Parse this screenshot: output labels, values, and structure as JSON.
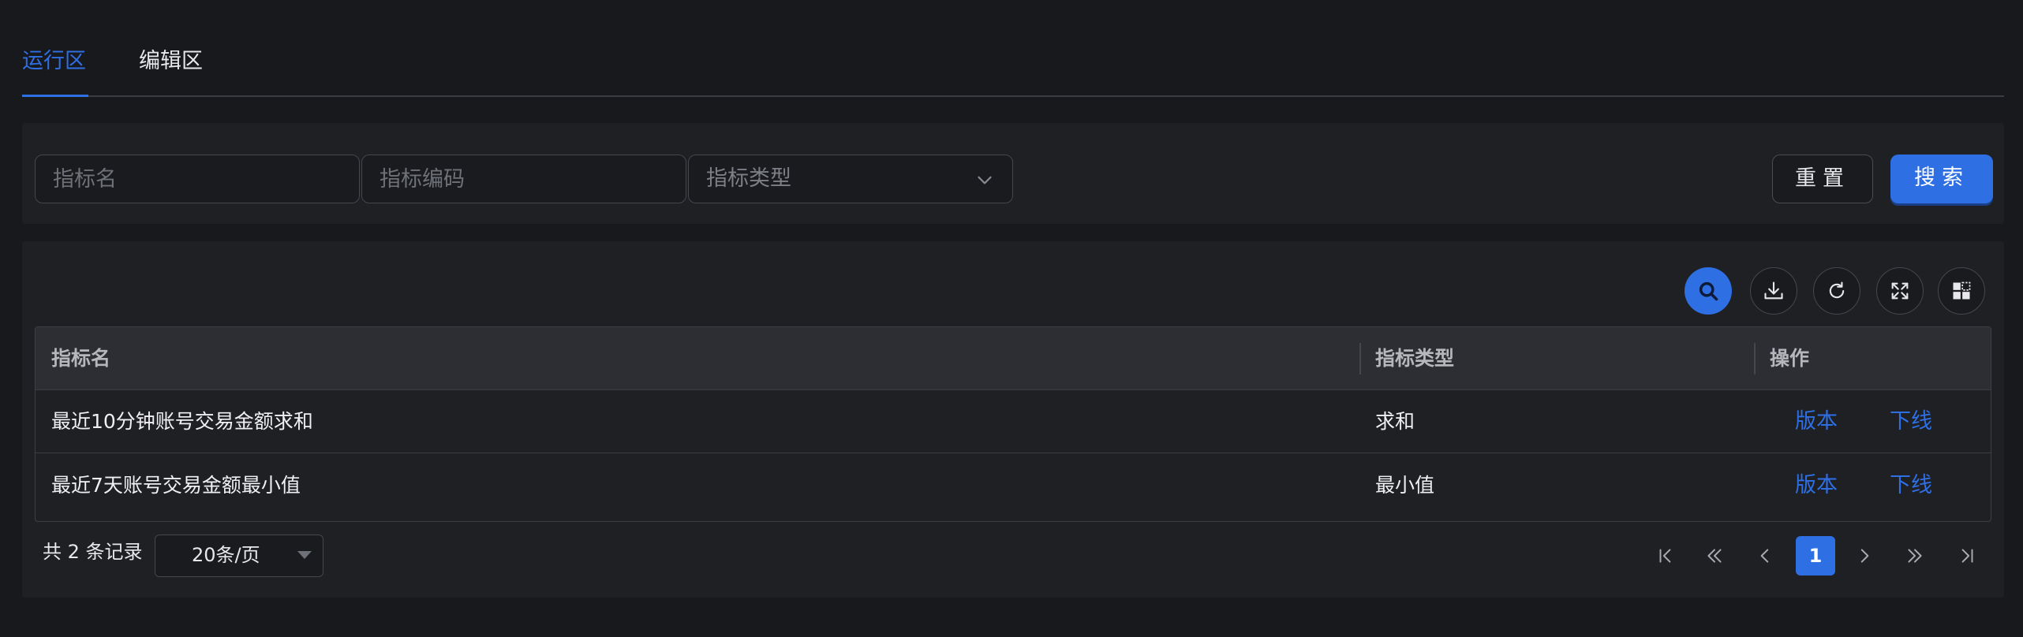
{
  "tabs": [
    {
      "label": "运行区",
      "active": true
    },
    {
      "label": "编辑区",
      "active": false
    }
  ],
  "search": {
    "name_placeholder": "指标名",
    "code_placeholder": "指标编码",
    "type_placeholder": "指标类型",
    "reset_label": "重置",
    "search_label": "搜索"
  },
  "toolbar": {
    "icons": [
      "search-icon",
      "download-icon",
      "refresh-icon",
      "fullscreen-icon",
      "columns-icon"
    ]
  },
  "table": {
    "headers": [
      "指标名",
      "指标类型",
      "操作"
    ],
    "rows": [
      {
        "name": "最近10分钟账号交易金额求和",
        "type": "求和",
        "actions": [
          "版本",
          "下线"
        ]
      },
      {
        "name": "最近7天账号交易金额最小值",
        "type": "最小值",
        "actions": [
          "版本",
          "下线"
        ]
      }
    ]
  },
  "pagination": {
    "total_text": "共 2 条记录",
    "page_size": "20条/页",
    "current_page": "1"
  },
  "colors": {
    "accent": "#2f6fe4",
    "background": "#18191d",
    "panel": "#1f2024"
  }
}
